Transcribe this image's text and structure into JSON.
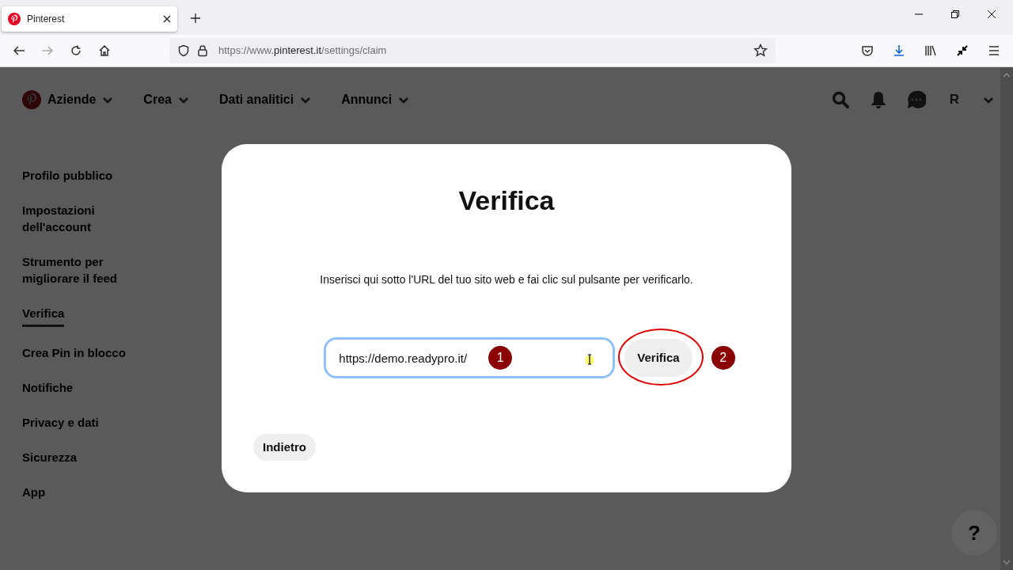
{
  "browser": {
    "tab": {
      "title": "Pinterest",
      "selected": true
    },
    "url": {
      "scheme": "https://www.",
      "host": "pinterest.it",
      "path": "/settings/claim"
    }
  },
  "nav": {
    "brand": "Aziende",
    "menus": [
      "Crea",
      "Dati analitici",
      "Annunci"
    ],
    "avatar": "R"
  },
  "sidebar": {
    "items": [
      {
        "label": "Profilo pubblico",
        "selected": false
      },
      {
        "label": "Impostazioni dell'account",
        "selected": false
      },
      {
        "label": "Strumento per migliorare il feed",
        "selected": false
      },
      {
        "label": "Verifica",
        "selected": true
      },
      {
        "label": "Crea Pin in blocco",
        "selected": false
      },
      {
        "label": "Notifiche",
        "selected": false
      },
      {
        "label": "Privacy e dati",
        "selected": false
      },
      {
        "label": "Sicurezza",
        "selected": false
      },
      {
        "label": "App",
        "selected": false
      }
    ]
  },
  "modal": {
    "title": "Verifica",
    "description": "Inserisci qui sotto l'URL del tuo sito web e fai clic sul pulsante per verificarlo.",
    "url_input": {
      "value": "https://demo.readypro.it/",
      "marker": "1"
    },
    "verify_button": {
      "label": "Verifica",
      "marker": "2"
    },
    "back_button": "Indietro"
  },
  "help_button": "?"
}
